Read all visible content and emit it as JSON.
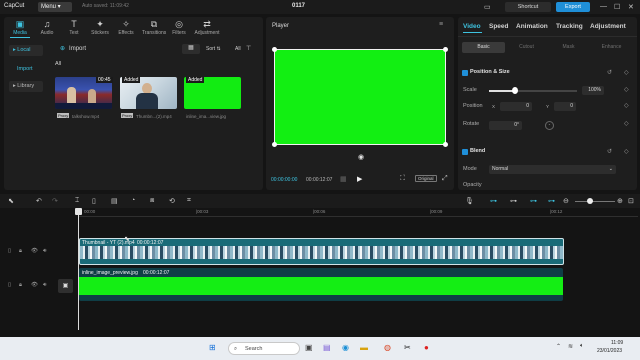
{
  "app": {
    "logo": "CapCut",
    "menu": "Menu",
    "autosave": "Auto saved: 11:09:42",
    "project_title": "0117",
    "shortcut": "Shortcut",
    "export": "Export",
    "window_controls": [
      "—",
      "☐",
      "✕"
    ]
  },
  "media": {
    "tools": [
      {
        "label": "Media",
        "icon": "media-icon",
        "glyph": "▣"
      },
      {
        "label": "Audio",
        "icon": "audio-icon",
        "glyph": "♫"
      },
      {
        "label": "Text",
        "icon": "text-icon",
        "glyph": "T"
      },
      {
        "label": "Stickers",
        "icon": "stickers-icon",
        "glyph": "✦"
      },
      {
        "label": "Effects",
        "icon": "effects-icon",
        "glyph": "✧"
      },
      {
        "label": "Transitions",
        "icon": "transitions-icon",
        "glyph": "⧉"
      },
      {
        "label": "Filters",
        "icon": "filters-icon",
        "glyph": "◎"
      },
      {
        "label": "Adjustment",
        "icon": "adjustment-icon",
        "glyph": "⇄"
      }
    ],
    "side": {
      "local": "Local",
      "import": "Import",
      "library": "Library"
    },
    "import_label": "Import",
    "sort": "Sort",
    "all_filter": "All",
    "all_label": "All",
    "items": [
      {
        "badge": "00:45",
        "file": "talkshow.mp4",
        "proxy": "Proxy"
      },
      {
        "badge": "Added",
        "file": "Thumbn...(2).mp4",
        "proxy": "Proxy"
      },
      {
        "badge": "Added",
        "file": "inline_ima...view.jpg"
      }
    ]
  },
  "player": {
    "title": "Player",
    "current": "00:00:00:00",
    "total": "00:00:12:07",
    "original": "Original"
  },
  "properties": {
    "tabs": [
      "Video",
      "Speed",
      "Animation",
      "Tracking",
      "Adjustment"
    ],
    "subtabs": [
      "Basic",
      "Cutout",
      "Mask",
      "Enhance"
    ],
    "position_size": "Position & Size",
    "scale_label": "Scale",
    "scale_value": "100%",
    "scale_fraction": 0.3,
    "position_label": "Position",
    "x_label": "X",
    "x_value": "0",
    "y_label": "Y",
    "y_value": "0",
    "rotate_label": "Rotate",
    "rotate_value": "0°",
    "blend": "Blend",
    "mode_label": "Mode",
    "mode_value": "Normal",
    "opacity_label": "Opacity"
  },
  "timeline": {
    "ticks": [
      "00:00",
      "|00:03",
      "|00:06",
      "|00:09",
      "|00:12"
    ],
    "clip1": {
      "name": "Thumbnail - YT (2).mp4",
      "duration": "00:00:12:07"
    },
    "clip2": {
      "name": "inline_image_preview.jpg",
      "duration": "00:00:12:07"
    }
  },
  "taskbar": {
    "search": "Search",
    "time": "11:09",
    "date": "23/01/2023"
  }
}
